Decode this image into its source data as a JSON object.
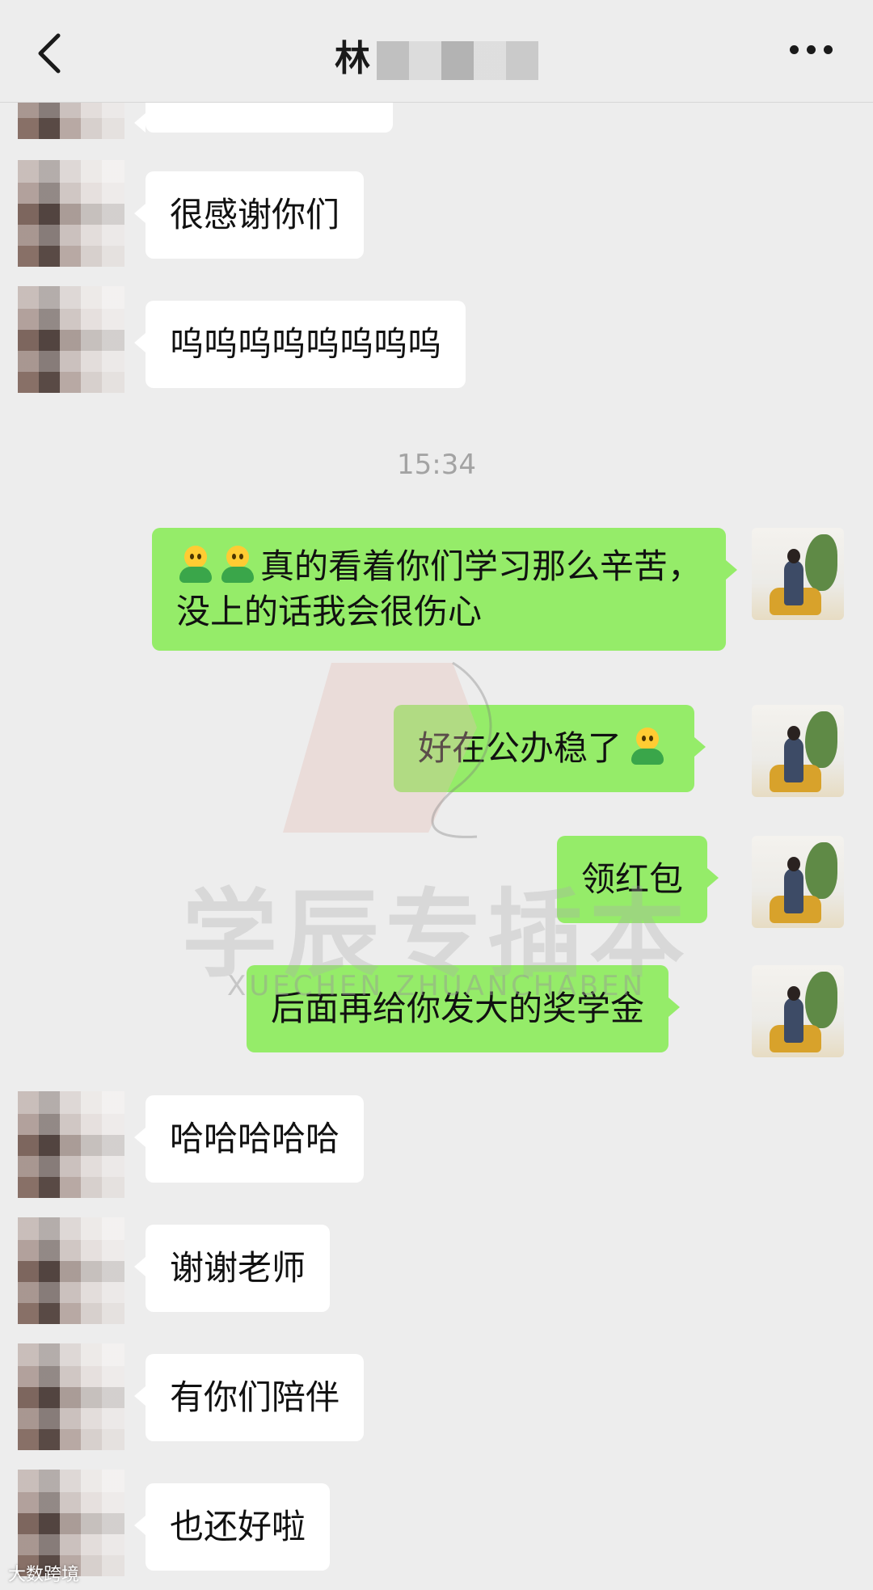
{
  "header": {
    "title": "林"
  },
  "messages": {
    "m1": "很感谢你们",
    "m2": "呜呜呜呜呜呜呜呜",
    "time": "15:34",
    "r1": "真的看着你们学习那么辛苦，没上的话我会很伤心",
    "r2": "好在公办稳了",
    "r3": "领红包",
    "r4": "后面再给你发大的奖学金",
    "m3": "哈哈哈哈哈",
    "m4": "谢谢老师",
    "m5": "有你们陪伴",
    "m6": "也还好啦"
  },
  "watermark": {
    "text": "学辰专插本",
    "sub": "XUECHEN ZHUANCHABEN"
  },
  "corner": {
    "text": "大数跨境"
  },
  "icons": {
    "back": "chevron-left-icon",
    "more": "more-dots-icon",
    "emoji": "person-emoji-icon"
  }
}
